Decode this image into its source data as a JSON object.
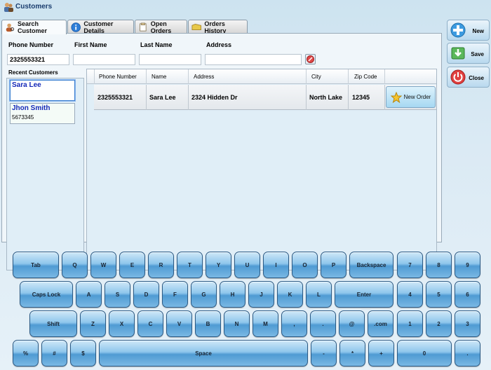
{
  "window": {
    "title": "Customers"
  },
  "tabs": [
    {
      "label": "Search Customer",
      "icon": "person-search-icon"
    },
    {
      "label": "Customer Details",
      "icon": "info-icon"
    },
    {
      "label": "Open Orders",
      "icon": "document-icon"
    },
    {
      "label": "Orders History",
      "icon": "folder-icon"
    }
  ],
  "search": {
    "labels": {
      "phone": "Phone Number",
      "first_name": "First Name",
      "last_name": "Last Name",
      "address": "Address"
    },
    "values": {
      "phone": "2325553321",
      "first_name": "",
      "last_name": "",
      "address": ""
    }
  },
  "recent": {
    "label": "Recent Customers",
    "items": [
      {
        "name": "Sara Lee",
        "phone": ""
      },
      {
        "name": "Jhon Smith",
        "phone": "5673345"
      }
    ]
  },
  "results": {
    "columns": [
      "Phone Number",
      "Name",
      "Address",
      "City",
      "Zip Code"
    ],
    "rows": [
      {
        "phone": "2325553321",
        "name": "Sara Lee",
        "address": "2324 Hidden Dr",
        "city": "North Lake",
        "zip": "12345",
        "action": "New Order"
      }
    ]
  },
  "actions": {
    "new": "New",
    "save": "Save",
    "close": "Close"
  },
  "keyboard": {
    "row1": [
      "Tab",
      "Q",
      "W",
      "E",
      "R",
      "T",
      "Y",
      "U",
      "I",
      "O",
      "P",
      "Backspace",
      "7",
      "8",
      "9"
    ],
    "row2": [
      "Caps Lock",
      "A",
      "S",
      "D",
      "F",
      "G",
      "H",
      "J",
      "K",
      "L",
      "Enter",
      "4",
      "5",
      "6"
    ],
    "row3": [
      "Shift",
      "Z",
      "X",
      "C",
      "V",
      "B",
      "N",
      "M",
      ",",
      ".",
      "@",
      ".com",
      "1",
      "2",
      "3"
    ],
    "row4": [
      "%",
      "#",
      "$",
      "Space",
      "-",
      "*",
      "+",
      "0",
      "."
    ]
  }
}
